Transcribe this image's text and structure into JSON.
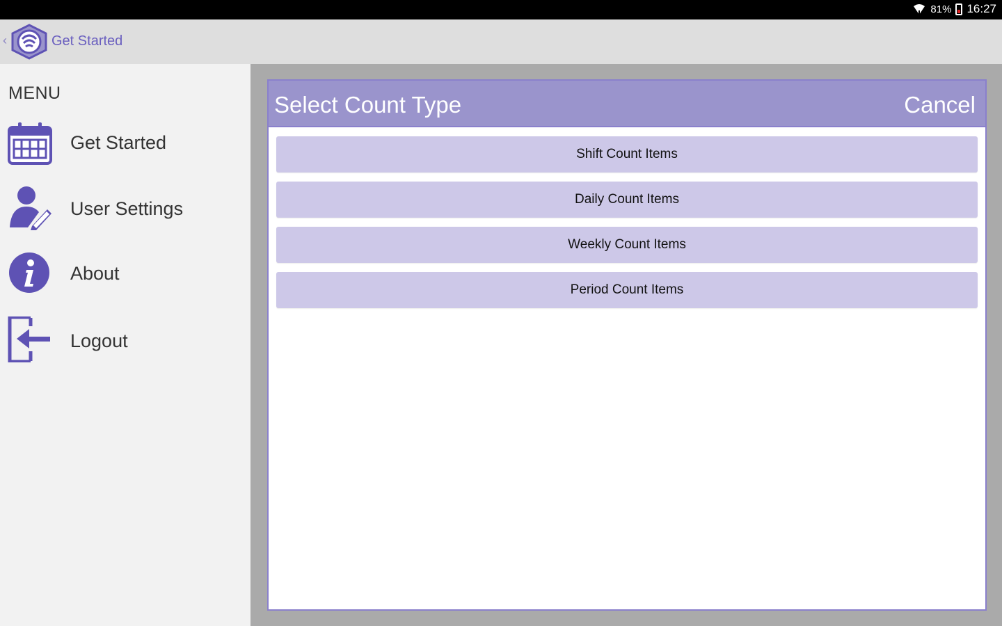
{
  "colors": {
    "accent": "#5e52b4",
    "header_purple": "#9a94cc",
    "button_purple": "#cdc8e8",
    "sidebar_bg": "#f2f2f2",
    "backdrop": "#aaaaaa"
  },
  "status_bar": {
    "wifi_icon": "wifi-icon",
    "battery_percent": "81%",
    "battery_icon": "battery-low-icon",
    "time": "16:27"
  },
  "action_bar": {
    "back_icon": "chevron-left-icon",
    "logo_icon": "app-logo-icon",
    "title": "Get Started"
  },
  "menu": {
    "heading": "MENU",
    "items": [
      {
        "label": "Get Started",
        "icon": "calendar-icon"
      },
      {
        "label": "User Settings",
        "icon": "user-edit-icon"
      },
      {
        "label": "About",
        "icon": "info-icon"
      },
      {
        "label": "Logout",
        "icon": "logout-icon"
      }
    ]
  },
  "dialog": {
    "title": "Select Count Type",
    "cancel_label": "Cancel",
    "options": [
      "Shift Count Items",
      "Daily Count Items",
      "Weekly Count Items",
      "Period Count Items"
    ]
  }
}
